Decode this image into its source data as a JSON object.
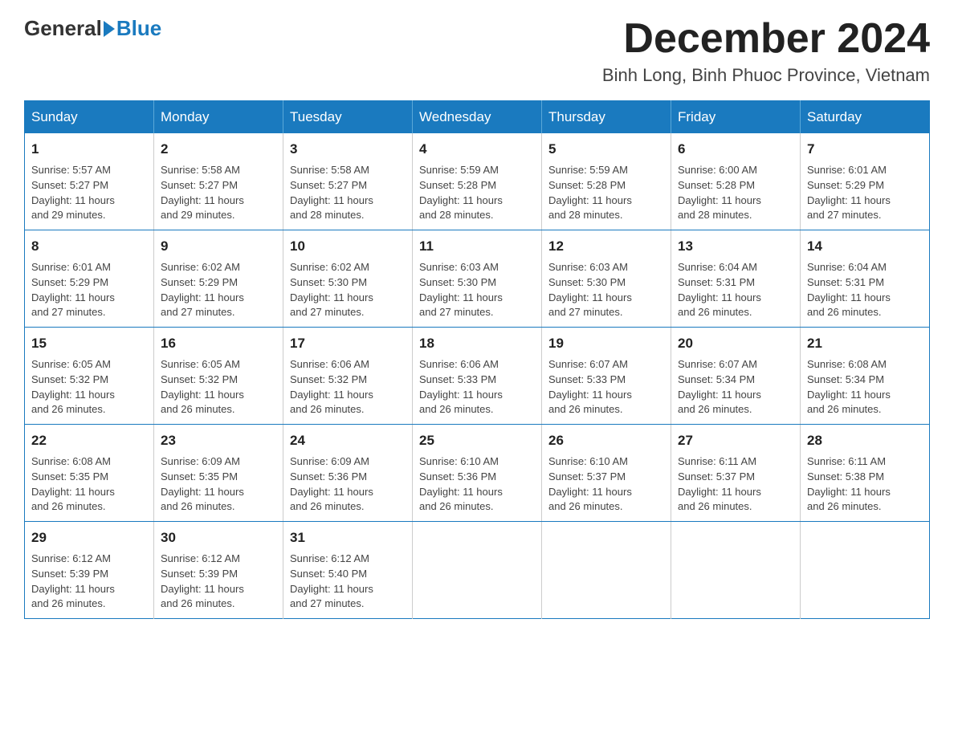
{
  "header": {
    "logo_general": "General",
    "logo_blue": "Blue",
    "month_title": "December 2024",
    "location": "Binh Long, Binh Phuoc Province, Vietnam"
  },
  "weekdays": [
    "Sunday",
    "Monday",
    "Tuesday",
    "Wednesday",
    "Thursday",
    "Friday",
    "Saturday"
  ],
  "weeks": [
    [
      {
        "day": "1",
        "sunrise": "5:57 AM",
        "sunset": "5:27 PM",
        "daylight": "11 hours and 29 minutes."
      },
      {
        "day": "2",
        "sunrise": "5:58 AM",
        "sunset": "5:27 PM",
        "daylight": "11 hours and 29 minutes."
      },
      {
        "day": "3",
        "sunrise": "5:58 AM",
        "sunset": "5:27 PM",
        "daylight": "11 hours and 28 minutes."
      },
      {
        "day": "4",
        "sunrise": "5:59 AM",
        "sunset": "5:28 PM",
        "daylight": "11 hours and 28 minutes."
      },
      {
        "day": "5",
        "sunrise": "5:59 AM",
        "sunset": "5:28 PM",
        "daylight": "11 hours and 28 minutes."
      },
      {
        "day": "6",
        "sunrise": "6:00 AM",
        "sunset": "5:28 PM",
        "daylight": "11 hours and 28 minutes."
      },
      {
        "day": "7",
        "sunrise": "6:01 AM",
        "sunset": "5:29 PM",
        "daylight": "11 hours and 27 minutes."
      }
    ],
    [
      {
        "day": "8",
        "sunrise": "6:01 AM",
        "sunset": "5:29 PM",
        "daylight": "11 hours and 27 minutes."
      },
      {
        "day": "9",
        "sunrise": "6:02 AM",
        "sunset": "5:29 PM",
        "daylight": "11 hours and 27 minutes."
      },
      {
        "day": "10",
        "sunrise": "6:02 AM",
        "sunset": "5:30 PM",
        "daylight": "11 hours and 27 minutes."
      },
      {
        "day": "11",
        "sunrise": "6:03 AM",
        "sunset": "5:30 PM",
        "daylight": "11 hours and 27 minutes."
      },
      {
        "day": "12",
        "sunrise": "6:03 AM",
        "sunset": "5:30 PM",
        "daylight": "11 hours and 27 minutes."
      },
      {
        "day": "13",
        "sunrise": "6:04 AM",
        "sunset": "5:31 PM",
        "daylight": "11 hours and 26 minutes."
      },
      {
        "day": "14",
        "sunrise": "6:04 AM",
        "sunset": "5:31 PM",
        "daylight": "11 hours and 26 minutes."
      }
    ],
    [
      {
        "day": "15",
        "sunrise": "6:05 AM",
        "sunset": "5:32 PM",
        "daylight": "11 hours and 26 minutes."
      },
      {
        "day": "16",
        "sunrise": "6:05 AM",
        "sunset": "5:32 PM",
        "daylight": "11 hours and 26 minutes."
      },
      {
        "day": "17",
        "sunrise": "6:06 AM",
        "sunset": "5:32 PM",
        "daylight": "11 hours and 26 minutes."
      },
      {
        "day": "18",
        "sunrise": "6:06 AM",
        "sunset": "5:33 PM",
        "daylight": "11 hours and 26 minutes."
      },
      {
        "day": "19",
        "sunrise": "6:07 AM",
        "sunset": "5:33 PM",
        "daylight": "11 hours and 26 minutes."
      },
      {
        "day": "20",
        "sunrise": "6:07 AM",
        "sunset": "5:34 PM",
        "daylight": "11 hours and 26 minutes."
      },
      {
        "day": "21",
        "sunrise": "6:08 AM",
        "sunset": "5:34 PM",
        "daylight": "11 hours and 26 minutes."
      }
    ],
    [
      {
        "day": "22",
        "sunrise": "6:08 AM",
        "sunset": "5:35 PM",
        "daylight": "11 hours and 26 minutes."
      },
      {
        "day": "23",
        "sunrise": "6:09 AM",
        "sunset": "5:35 PM",
        "daylight": "11 hours and 26 minutes."
      },
      {
        "day": "24",
        "sunrise": "6:09 AM",
        "sunset": "5:36 PM",
        "daylight": "11 hours and 26 minutes."
      },
      {
        "day": "25",
        "sunrise": "6:10 AM",
        "sunset": "5:36 PM",
        "daylight": "11 hours and 26 minutes."
      },
      {
        "day": "26",
        "sunrise": "6:10 AM",
        "sunset": "5:37 PM",
        "daylight": "11 hours and 26 minutes."
      },
      {
        "day": "27",
        "sunrise": "6:11 AM",
        "sunset": "5:37 PM",
        "daylight": "11 hours and 26 minutes."
      },
      {
        "day": "28",
        "sunrise": "6:11 AM",
        "sunset": "5:38 PM",
        "daylight": "11 hours and 26 minutes."
      }
    ],
    [
      {
        "day": "29",
        "sunrise": "6:12 AM",
        "sunset": "5:39 PM",
        "daylight": "11 hours and 26 minutes."
      },
      {
        "day": "30",
        "sunrise": "6:12 AM",
        "sunset": "5:39 PM",
        "daylight": "11 hours and 26 minutes."
      },
      {
        "day": "31",
        "sunrise": "6:12 AM",
        "sunset": "5:40 PM",
        "daylight": "11 hours and 27 minutes."
      },
      null,
      null,
      null,
      null
    ]
  ],
  "labels": {
    "sunrise": "Sunrise:",
    "sunset": "Sunset:",
    "daylight": "Daylight:"
  }
}
